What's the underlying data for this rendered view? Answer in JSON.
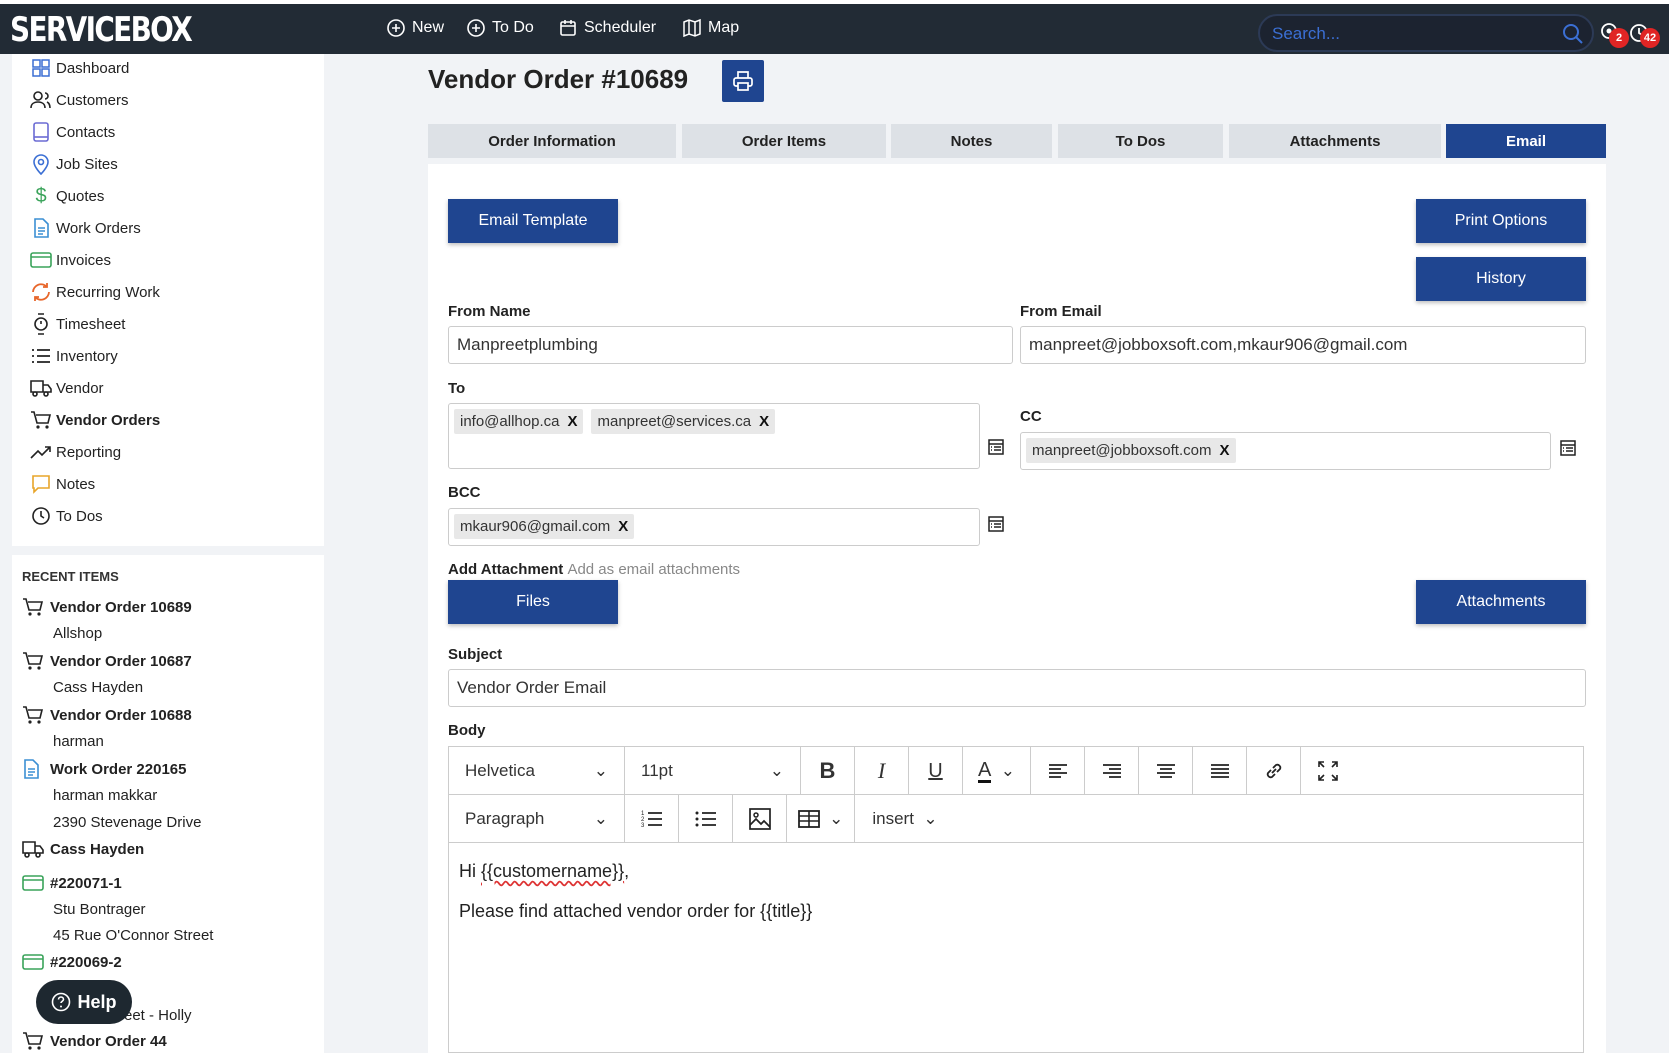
{
  "app": {
    "logo": "SERVICEBOX"
  },
  "nav": {
    "new": "New",
    "todo": "To Do",
    "scheduler": "Scheduler",
    "map": "Map",
    "search_placeholder": "Search...",
    "badge_location": "2",
    "badge_clock": "42"
  },
  "sidebar": {
    "items": [
      {
        "label": "Dashboard",
        "icon": "dashboard-icon"
      },
      {
        "label": "Customers",
        "icon": "customers-icon"
      },
      {
        "label": "Contacts",
        "icon": "contacts-icon"
      },
      {
        "label": "Job Sites",
        "icon": "location-pin-icon"
      },
      {
        "label": "Quotes",
        "icon": "dollar-icon"
      },
      {
        "label": "Work Orders",
        "icon": "document-icon"
      },
      {
        "label": "Invoices",
        "icon": "card-icon"
      },
      {
        "label": "Recurring Work",
        "icon": "recurring-icon"
      },
      {
        "label": "Timesheet",
        "icon": "watch-icon"
      },
      {
        "label": "Inventory",
        "icon": "list-icon"
      },
      {
        "label": "Vendor",
        "icon": "truck-icon"
      },
      {
        "label": "Vendor Orders",
        "icon": "cart-icon"
      },
      {
        "label": "Reporting",
        "icon": "trend-icon"
      },
      {
        "label": "Notes",
        "icon": "note-icon"
      },
      {
        "label": "To Dos",
        "icon": "clock-icon"
      }
    ]
  },
  "recent": {
    "title": "RECENT ITEMS",
    "items": [
      {
        "label": "Vendor Order 10689",
        "sub": [
          "Allshop"
        ]
      },
      {
        "label": "Vendor Order 10687",
        "sub": [
          "Cass Hayden"
        ]
      },
      {
        "label": "Vendor Order 10688",
        "sub": [
          "harman"
        ]
      },
      {
        "label": "Work Order 220165",
        "sub": [
          "harman makkar",
          "2390 Stevenage Drive"
        ]
      },
      {
        "label": "Cass Hayden",
        "sub": []
      },
      {
        "label": "#220071-1",
        "sub": [
          "Stu Bontrager",
          "45 Rue O'Connor Street"
        ]
      },
      {
        "label": "#220069-2",
        "sub": [
          "eet - Holly"
        ]
      },
      {
        "label": "Vendor Order 44",
        "sub": []
      }
    ]
  },
  "help": "Help",
  "page": {
    "title": "Vendor Order #10689",
    "tabs": [
      "Order Information",
      "Order Items",
      "Notes",
      "To Dos",
      "Attachments",
      "Email"
    ],
    "active_tab": "Email"
  },
  "email": {
    "email_template": "Email Template",
    "print_options": "Print Options",
    "history": "History",
    "from_name_label": "From Name",
    "from_name": "Manpreetplumbing",
    "from_email_label": "From Email",
    "from_email": "manpreet@jobboxsoft.com,mkaur906@gmail.com",
    "to_label": "To",
    "to": [
      "info@allhop.ca",
      "manpreet@services.ca"
    ],
    "cc_label": "CC",
    "cc": [
      "manpreet@jobboxsoft.com"
    ],
    "bcc_label": "BCC",
    "bcc": [
      "mkaur906@gmail.com"
    ],
    "add_attachment_label": "Add Attachment",
    "add_attachment_hint": "Add as email attachments",
    "files": "Files",
    "attachments": "Attachments",
    "subject_label": "Subject",
    "subject": "Vendor Order Email",
    "body_label": "Body",
    "tag_remove": "X"
  },
  "editor": {
    "font": "Helvetica",
    "size": "11pt",
    "block": "Paragraph",
    "insert": "insert",
    "body_greeting_prefix": "Hi ",
    "body_var": "{{customername}}",
    "body_greeting_suffix": ",",
    "body_line2": "Please find attached vendor order for {{title}}"
  },
  "colors": {
    "primary": "#1f4590",
    "navbar": "#222b35",
    "tab_inactive": "#dde1e6"
  }
}
